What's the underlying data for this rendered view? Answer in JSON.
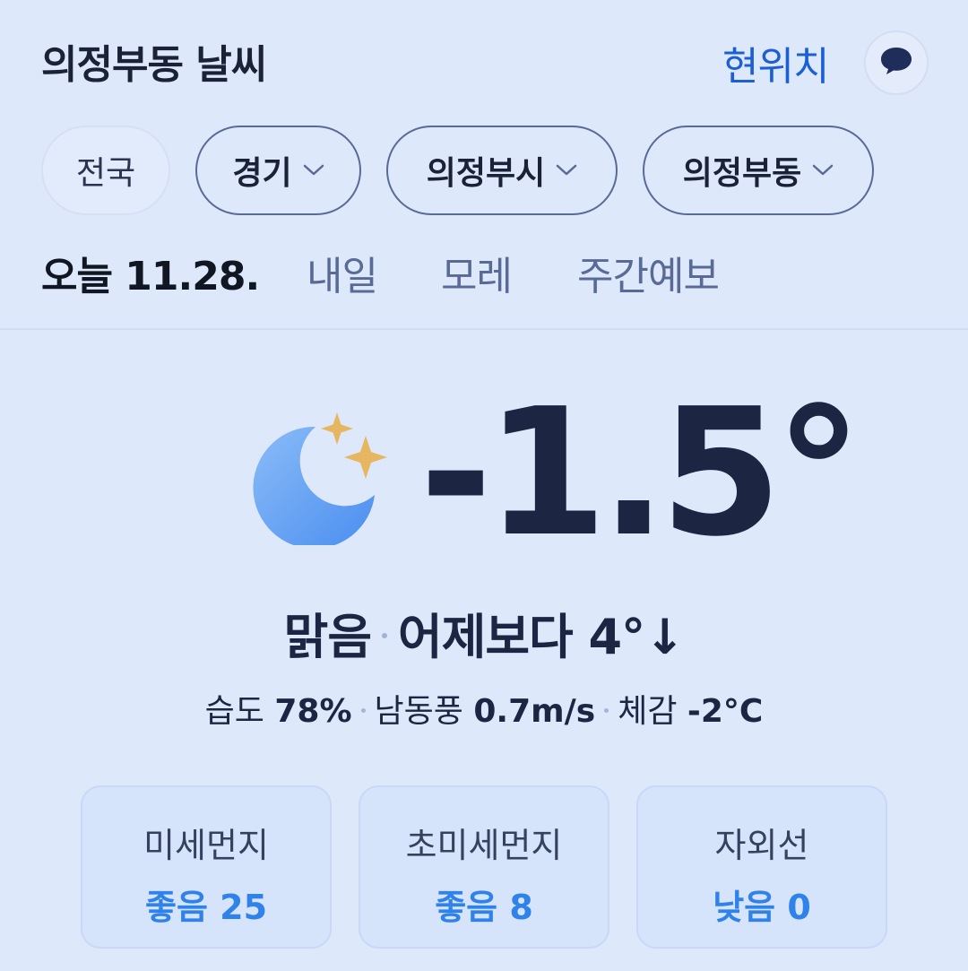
{
  "header": {
    "title": "의정부동 날씨",
    "location_link": "현위치"
  },
  "regions": {
    "nationwide": "전국",
    "province": "경기",
    "city": "의정부시",
    "dong": "의정부동"
  },
  "tabs": {
    "today": "오늘 11.28.",
    "tomorrow": "내일",
    "day_after": "모레",
    "weekly": "주간예보"
  },
  "current": {
    "icon": "moon-stars-icon",
    "temperature": "-1.5°",
    "condition": "맑음",
    "comparison": "어제보다 4°↓"
  },
  "details": {
    "humidity_label": "습도",
    "humidity_value": "78%",
    "wind_label": "남동풍",
    "wind_value": "0.7m/s",
    "feels_label": "체감",
    "feels_value": "-2°C"
  },
  "cards": {
    "pm10_label": "미세먼지",
    "pm10_value": "좋음 25",
    "pm25_label": "초미세먼지",
    "pm25_value": "좋음 8",
    "uv_label": "자외선",
    "uv_value": "낮음 0"
  },
  "colors": {
    "background": "#dde8fb",
    "accent_link": "#1a5fd6",
    "good_value": "#2f82ea",
    "text_dark": "#1c2541",
    "moon": "#5b9ef2",
    "star": "#e7b660"
  }
}
